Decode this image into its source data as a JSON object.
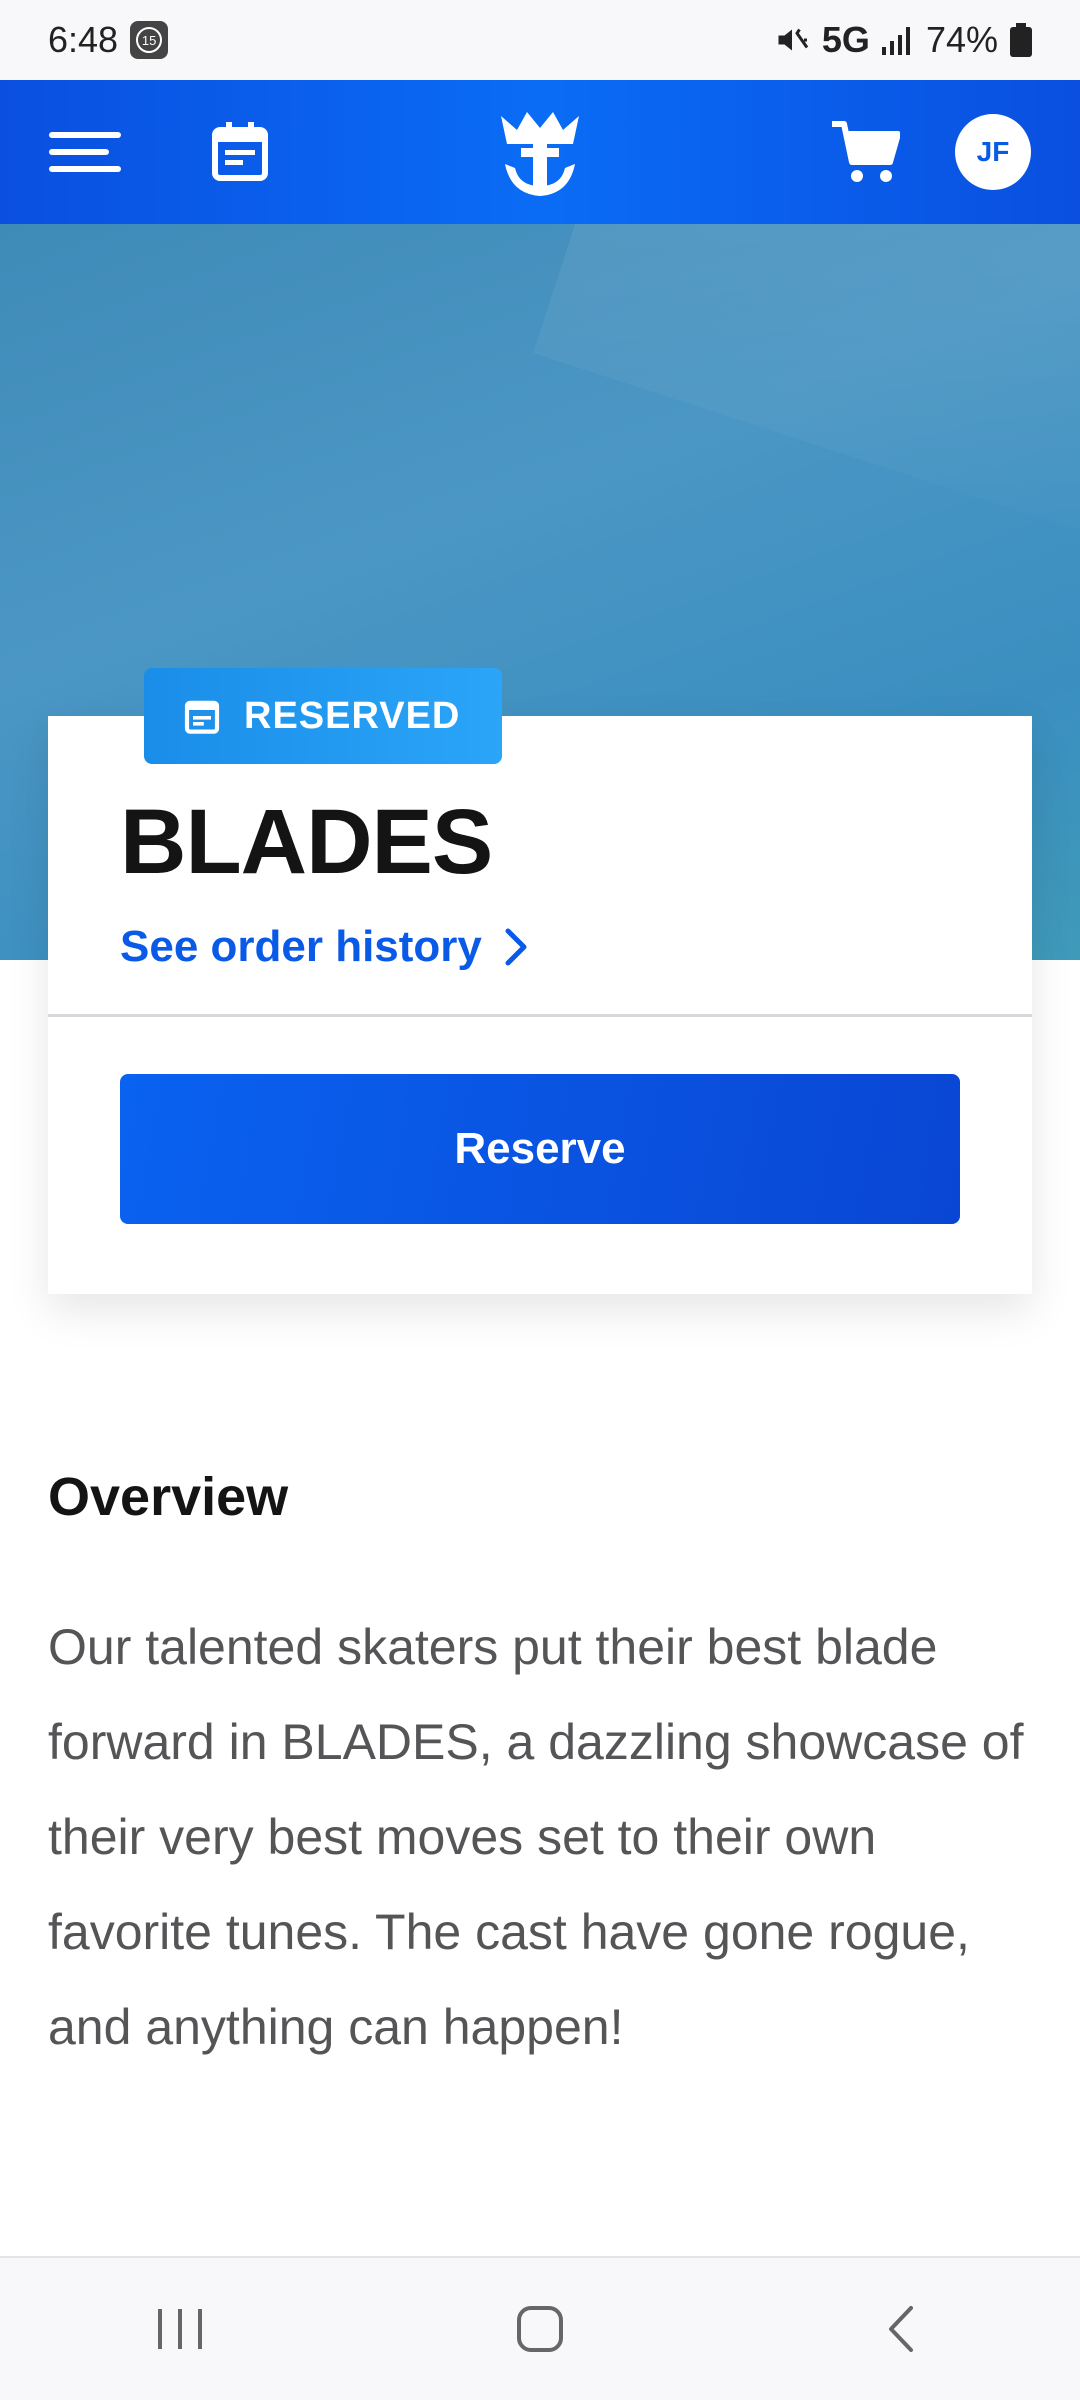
{
  "status_bar": {
    "time": "6:48",
    "notification_badge": "15",
    "network": "5G",
    "battery": "74%"
  },
  "header": {
    "avatar_initials": "JF",
    "icons": [
      "menu-icon",
      "calendar-icon",
      "crown-anchor-logo",
      "cart-icon"
    ]
  },
  "card": {
    "status_tag": "RESERVED",
    "title": "BLADES",
    "order_link": "See order history",
    "reserve_button": "Reserve"
  },
  "overview": {
    "heading": "Overview",
    "body": "Our talented skaters put their best blade forward in BLADES, a dazzling showcase of their very best moves set to their own favorite tunes. The cast have gone rogue, and anything can happen!"
  },
  "colors": {
    "brand_blue": "#0a5ae8",
    "tag_blue": "#1a8de8",
    "hero_blue": "#4b96c4"
  },
  "nav_bar": {
    "icons": [
      "recent-apps-icon",
      "home-icon",
      "back-icon"
    ]
  }
}
